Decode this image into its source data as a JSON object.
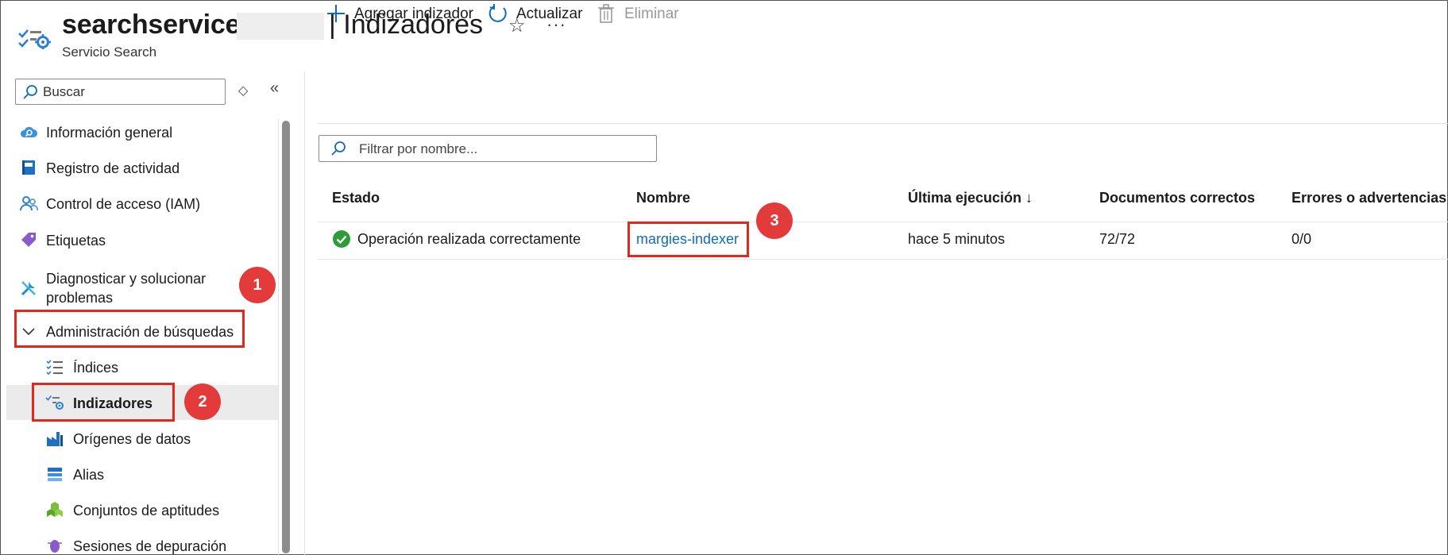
{
  "header": {
    "service_name": "searchservice-",
    "page_title": "| Indizadores",
    "subtitle": "Servicio Search",
    "star_glyph": "☆",
    "more_glyph": "···",
    "icon": "search-service-icon"
  },
  "sidebar": {
    "search_placeholder": "Buscar",
    "updown_glyph": "◇",
    "collapse_glyph": "«",
    "items": [
      {
        "label": "Información general",
        "icon": "cloud-search-icon"
      },
      {
        "label": "Registro de actividad",
        "icon": "activity-log-icon"
      },
      {
        "label": "Control de acceso (IAM)",
        "icon": "people-icon"
      },
      {
        "label": "Etiquetas",
        "icon": "tag-icon"
      },
      {
        "label_line1": "Diagnosticar y solucionar",
        "label_line2": "problemas",
        "icon": "wrench-icon"
      },
      {
        "label": "Administración de búsquedas",
        "icon": "chevron-down-icon",
        "expanded": true
      },
      {
        "label": "Índices",
        "icon": "list-check-icon"
      },
      {
        "label": "Indizadores",
        "icon": "indexer-icon",
        "selected": true
      },
      {
        "label": "Orígenes de datos",
        "icon": "factory-icon"
      },
      {
        "label": "Alias",
        "icon": "alias-icon"
      },
      {
        "label": "Conjuntos de aptitudes",
        "icon": "cubes-icon"
      },
      {
        "label": "Sesiones de depuración",
        "icon": "bug-icon"
      }
    ]
  },
  "toolbar": {
    "add_label": "Agregar indizador",
    "refresh_label": "Actualizar",
    "delete_label": "Eliminar"
  },
  "filter": {
    "placeholder": "Filtrar por nombre..."
  },
  "table": {
    "headers": [
      "Estado",
      "Nombre",
      "Última ejecución ↓",
      "Documentos correctos",
      "Errores o advertencias"
    ],
    "rows": [
      {
        "status": "Operación realizada correctamente",
        "name": "margies-indexer",
        "last_run": "hace 5 minutos",
        "docs": "72/72",
        "errors": "0/0"
      }
    ]
  },
  "annotations": {
    "badge1": "1",
    "badge2": "2",
    "badge3": "3",
    "color": "#e3281b"
  },
  "colors": {
    "accent": "#0f6cbd",
    "success": "#2d9d39",
    "selected_bg": "#ebebeb"
  }
}
